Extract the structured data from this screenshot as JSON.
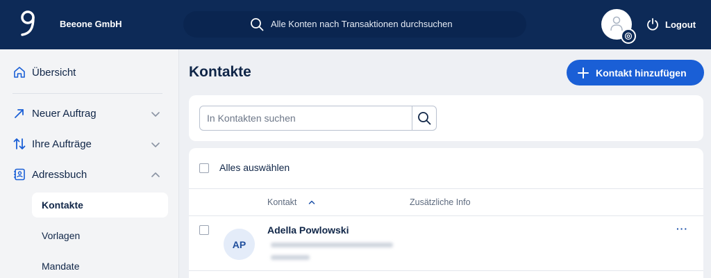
{
  "header": {
    "company": "Beeone GmbH",
    "search_text": "Alle Konten nach Transaktionen durchsuchen",
    "logout_label": "Logout"
  },
  "sidebar": {
    "items": [
      {
        "label": "Übersicht",
        "icon": "home-icon"
      },
      {
        "label": "Neuer Auftrag",
        "icon": "arrow-up-right-icon"
      },
      {
        "label": "Ihre Aufträge",
        "icon": "arrows-up-down-icon"
      },
      {
        "label": "Adressbuch",
        "icon": "address-book-icon"
      }
    ],
    "sub_items": [
      {
        "label": "Kontakte",
        "active": true
      },
      {
        "label": "Vorlagen",
        "active": false
      },
      {
        "label": "Mandate",
        "active": false
      }
    ]
  },
  "main": {
    "title": "Kontakte",
    "add_button": "Kontakt hinzufügen",
    "search_placeholder": "In Kontakten suchen",
    "select_all": "Alles auswählen",
    "columns": [
      "Kontakt",
      "Zusätzliche Info"
    ],
    "rows": [
      {
        "initials": "AP",
        "name": "Adella Powlowski"
      }
    ],
    "more_label": "···"
  },
  "colors": {
    "header_bg": "#0d2a57",
    "accent": "#1a5fd6",
    "page_bg": "#eef0f4"
  }
}
